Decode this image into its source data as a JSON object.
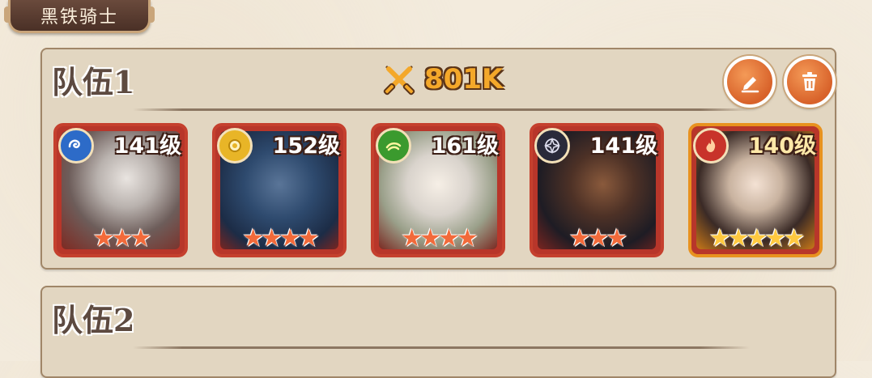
{
  "title": "黑铁骑士",
  "teams": [
    {
      "name": "队伍1",
      "power": "801K",
      "heroes": [
        {
          "level": "141级",
          "faction": "water-icon",
          "stars": "★★★",
          "color": "#2d6bc8",
          "tier": "red"
        },
        {
          "level": "152级",
          "faction": "light-icon",
          "stars": "★★★★",
          "color": "#e8b527",
          "tier": "red"
        },
        {
          "level": "161级",
          "faction": "nature-icon",
          "stars": "★★★★",
          "color": "#3b9a2e",
          "tier": "red"
        },
        {
          "level": "141级",
          "faction": "dark-icon",
          "stars": "★★★",
          "color": "#2a2a3a",
          "tier": "red"
        },
        {
          "level": "140级",
          "faction": "fire-icon",
          "stars": "★★★★★",
          "color": "#c8332a",
          "tier": "gold"
        }
      ]
    },
    {
      "name": "队伍2"
    }
  ]
}
